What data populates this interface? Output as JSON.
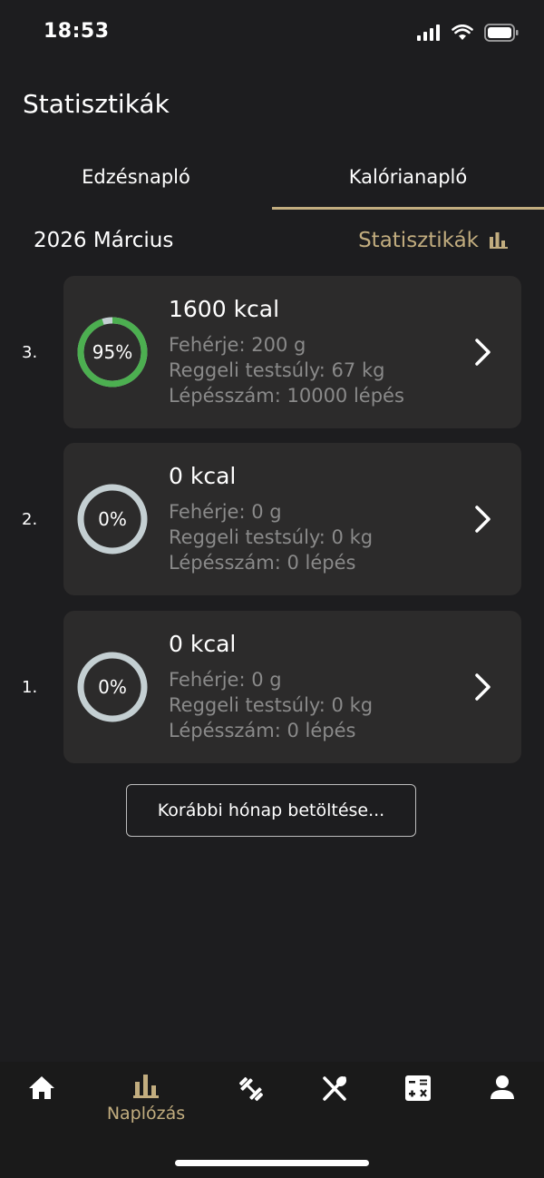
{
  "status_bar": {
    "time": "18:53"
  },
  "header": {
    "title": "Statisztikák"
  },
  "tabs": [
    {
      "label": "Edzésnapló",
      "active": false
    },
    {
      "label": "Kalórianapló",
      "active": true
    }
  ],
  "month_bar": {
    "month": "2026 Március",
    "stats_link": "Statisztikák",
    "stats_icon": "bar-chart-icon"
  },
  "entries": [
    {
      "index": "3.",
      "percent_label": "95%",
      "progress": 0.95,
      "kcal": "1600 kcal",
      "protein": "Fehérje: 200 g",
      "weight": "Reggeli testsúly: 67 kg",
      "steps": "Lépésszám: 10000 lépés"
    },
    {
      "index": "2.",
      "percent_label": "0%",
      "progress": 0,
      "kcal": "0 kcal",
      "protein": "Fehérje: 0 g",
      "weight": "Reggeli testsúly: 0 kg",
      "steps": "Lépésszám: 0 lépés"
    },
    {
      "index": "1.",
      "percent_label": "0%",
      "progress": 0,
      "kcal": "0 kcal",
      "protein": "Fehérje: 0 g",
      "weight": "Reggeli testsúly: 0 kg",
      "steps": "Lépésszám: 0 lépés"
    }
  ],
  "load_more": {
    "label": "Korábbi hónap betöltése..."
  },
  "bottom_nav": [
    {
      "icon": "home-icon",
      "label": "",
      "active": false
    },
    {
      "icon": "bar-chart-icon",
      "label": "Naplózás",
      "active": true
    },
    {
      "icon": "dumbbell-icon",
      "label": "",
      "active": false
    },
    {
      "icon": "utensils-icon",
      "label": "",
      "active": false
    },
    {
      "icon": "calculator-icon",
      "label": "",
      "active": false
    },
    {
      "icon": "user-icon",
      "label": "",
      "active": false
    }
  ],
  "colors": {
    "background": "#1d1d1f",
    "card": "#2c2b2b",
    "accent": "#c2ad7f",
    "progress_green": "#4caf50",
    "ring_track": "#c4cfd2",
    "muted_text": "#8a8a8a"
  }
}
